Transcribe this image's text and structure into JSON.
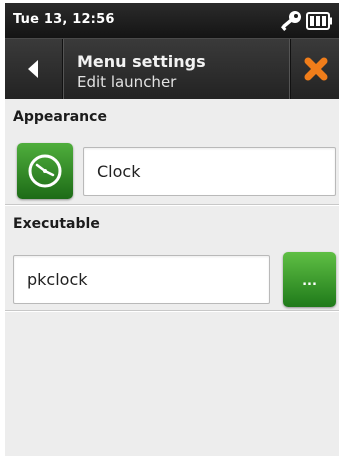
{
  "status_bar": {
    "datetime": "Tue 13, 12:56",
    "icons": [
      "key-icon",
      "battery-icon"
    ]
  },
  "title_bar": {
    "title": "Menu settings",
    "subtitle": "Edit launcher",
    "back_icon": "arrow-left-icon",
    "close_icon": "close-icon"
  },
  "appearance": {
    "header": "Appearance",
    "icon": "clock-icon",
    "name_value": "Clock"
  },
  "executable": {
    "header": "Executable",
    "command_value": "pkclock",
    "browse_label": "..."
  },
  "colors": {
    "accent_green": "#2f8f22",
    "close_orange": "#f07d1a",
    "bar_dark": "#2a2a2a"
  }
}
